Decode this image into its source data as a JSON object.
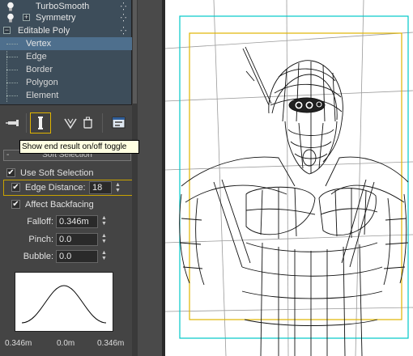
{
  "modifier_stack": {
    "items": [
      {
        "label": "TurboSmooth",
        "icon": "lightbulb-icon"
      },
      {
        "label": "Symmetry",
        "icon": "lightbulb-icon",
        "expander": "+"
      },
      {
        "label": "Editable Poly",
        "expander": "−"
      }
    ],
    "subobjects": [
      "Vertex",
      "Edge",
      "Border",
      "Polygon",
      "Element"
    ],
    "selected_subobject": "Vertex"
  },
  "toolbar": {
    "buttons": [
      "pin-stack-icon",
      "show-end-result-icon",
      "make-unique-icon",
      "remove-modifier-icon",
      "configure-sets-icon"
    ],
    "tooltip": "Show end result on/off toggle"
  },
  "soft_selection": {
    "header": "Soft Selection",
    "use_soft_selection": {
      "label": "Use Soft Selection",
      "checked": true
    },
    "edge_distance": {
      "label": "Edge Distance:",
      "checked": true,
      "value": "18"
    },
    "affect_backfacing": {
      "label": "Affect Backfacing",
      "checked": true
    },
    "falloff": {
      "label": "Falloff:",
      "value": "0.346m"
    },
    "pinch": {
      "label": "Pinch:",
      "value": "0.0"
    },
    "bubble": {
      "label": "Bubble:",
      "value": "0.0"
    },
    "curve_labels": {
      "left": "0.346m",
      "center": "0.0m",
      "right": "0.346m"
    }
  },
  "colors": {
    "selection_frame": "#e0b400",
    "safe_frame": "#00c8c8",
    "stack_bg": "#3d4d5a",
    "stack_selected": "#4e6f8d"
  }
}
